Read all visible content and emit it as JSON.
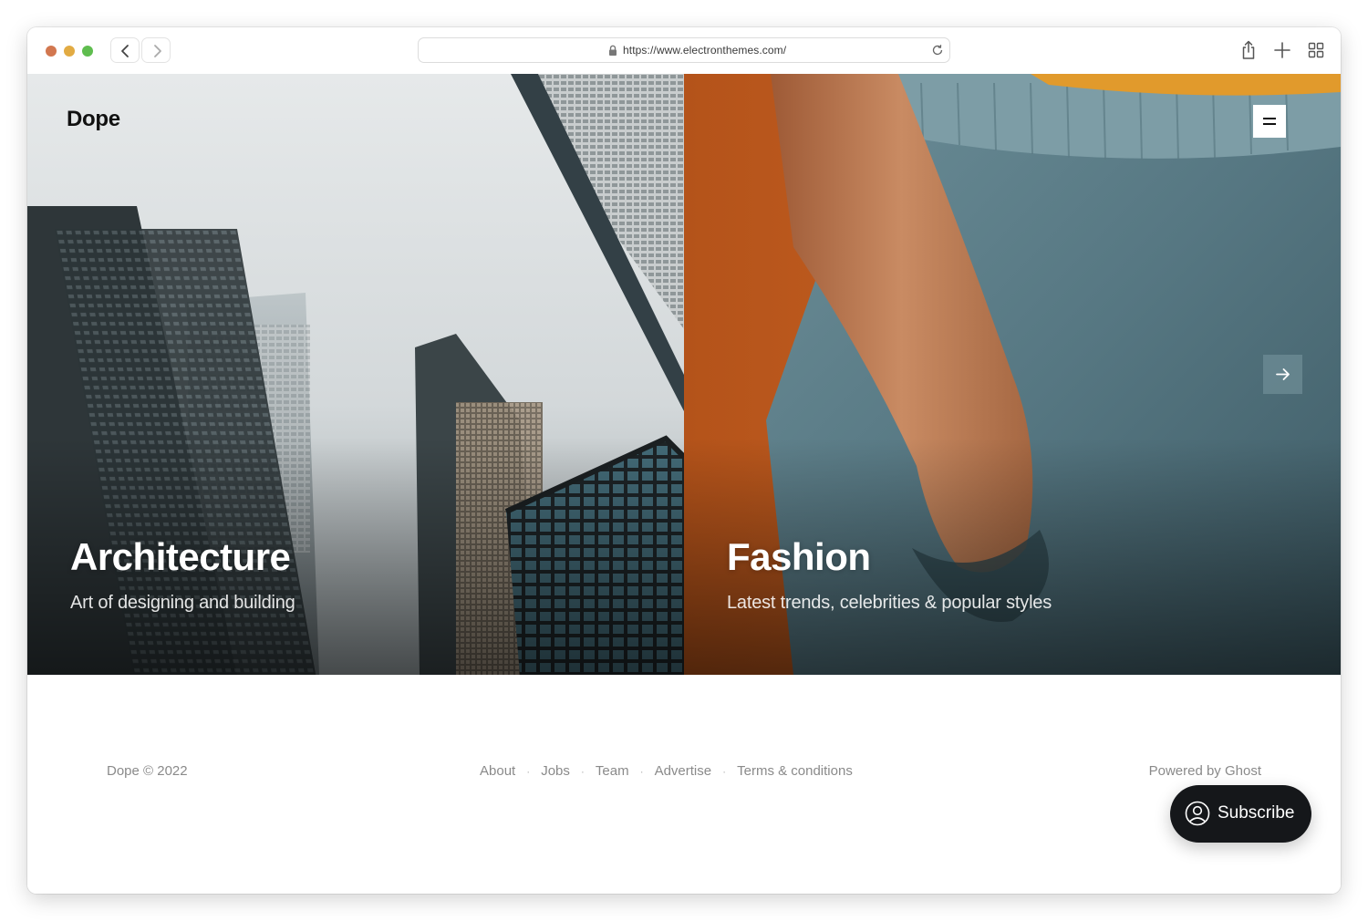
{
  "browser": {
    "url": "https://www.electronthemes.com/",
    "traffic_lights": [
      "#d2774f",
      "#e2ab43",
      "#5fbd4f"
    ],
    "icons": [
      "back-icon",
      "forward-icon",
      "lock-icon",
      "reload-icon",
      "share-icon",
      "new-tab-icon",
      "tab-overview-icon"
    ]
  },
  "site": {
    "logo": "Dope",
    "menu_icon": "hamburger-icon",
    "next_icon": "arrow-right-icon"
  },
  "panels": [
    {
      "title": "Architecture",
      "subtitle": "Art of designing and building"
    },
    {
      "title": "Fashion",
      "subtitle": "Latest trends, celebrities & popular styles"
    }
  ],
  "footer": {
    "copyright": "Dope © 2022",
    "nav": [
      "About",
      "Jobs",
      "Team",
      "Advertise",
      "Terms & conditions"
    ],
    "separator": "·",
    "powered": "Powered by Ghost"
  },
  "subscribe": {
    "label": "Subscribe",
    "icon": "user-circle-icon"
  }
}
